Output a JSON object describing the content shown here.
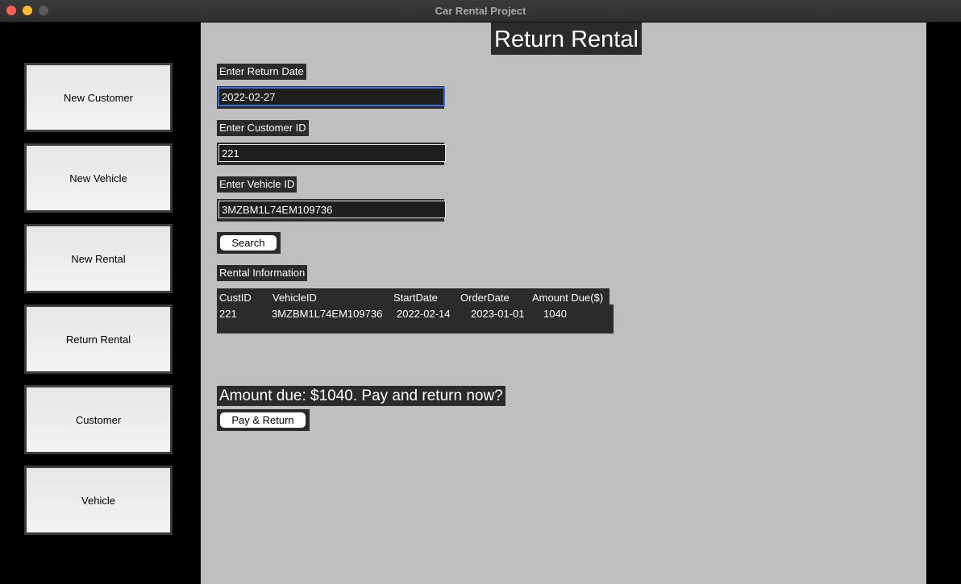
{
  "window": {
    "title": "Car Rental Project"
  },
  "sidebar": {
    "items": [
      {
        "label": "New Customer"
      },
      {
        "label": "New Vehicle"
      },
      {
        "label": "New Rental"
      },
      {
        "label": "Return Rental"
      },
      {
        "label": "Customer"
      },
      {
        "label": "Vehicle"
      }
    ]
  },
  "main": {
    "title": "Return Rental",
    "return_date": {
      "label": "Enter Return Date",
      "value": "2022-02-27"
    },
    "customer_id": {
      "label": "Enter Customer ID",
      "value": "221"
    },
    "vehicle_id": {
      "label": "Enter Vehicle ID",
      "value": "3MZBM1L74EM109736"
    },
    "search_label": "Search",
    "rental_info": {
      "label": "Rental Information",
      "headers": [
        "CustID",
        "VehicleID",
        "StartDate",
        "OrderDate",
        "Amount Due($)"
      ],
      "row": [
        "221",
        "3MZBM1L74EM109736",
        "2022-02-14",
        "2023-01-01",
        "1040"
      ]
    },
    "amount_prompt": "Amount due: $1040. Pay and return now?",
    "pay_return_label": "Pay & Return"
  }
}
